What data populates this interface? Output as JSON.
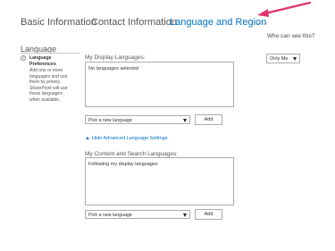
{
  "tabs": [
    {
      "label": "Basic Information"
    },
    {
      "label": "Contact Information"
    },
    {
      "label": "Language and Region",
      "active": true
    },
    {
      "label": "..."
    }
  ],
  "privacy": {
    "heading": "Who can see this?",
    "value": "Only Me"
  },
  "section": {
    "title": "Language"
  },
  "help": {
    "heading": "Language Preferences",
    "description": "Add one or more languages and sort them by priority. SharePoint will use these languages when available."
  },
  "display_languages": {
    "label": "My Display Languages:",
    "value": "No languages selected",
    "picker_value": "Pick a new language",
    "add_label": "Add"
  },
  "advanced_toggle": "Hide Advanced Language Settings",
  "content_languages": {
    "label": "My Content and Search Languages:",
    "value": "Following my display languages",
    "picker_value": "Pick a new language",
    "add_label": "Add"
  },
  "colors": {
    "accent": "#0072c6",
    "annotation_arrow": "#e0356a"
  }
}
